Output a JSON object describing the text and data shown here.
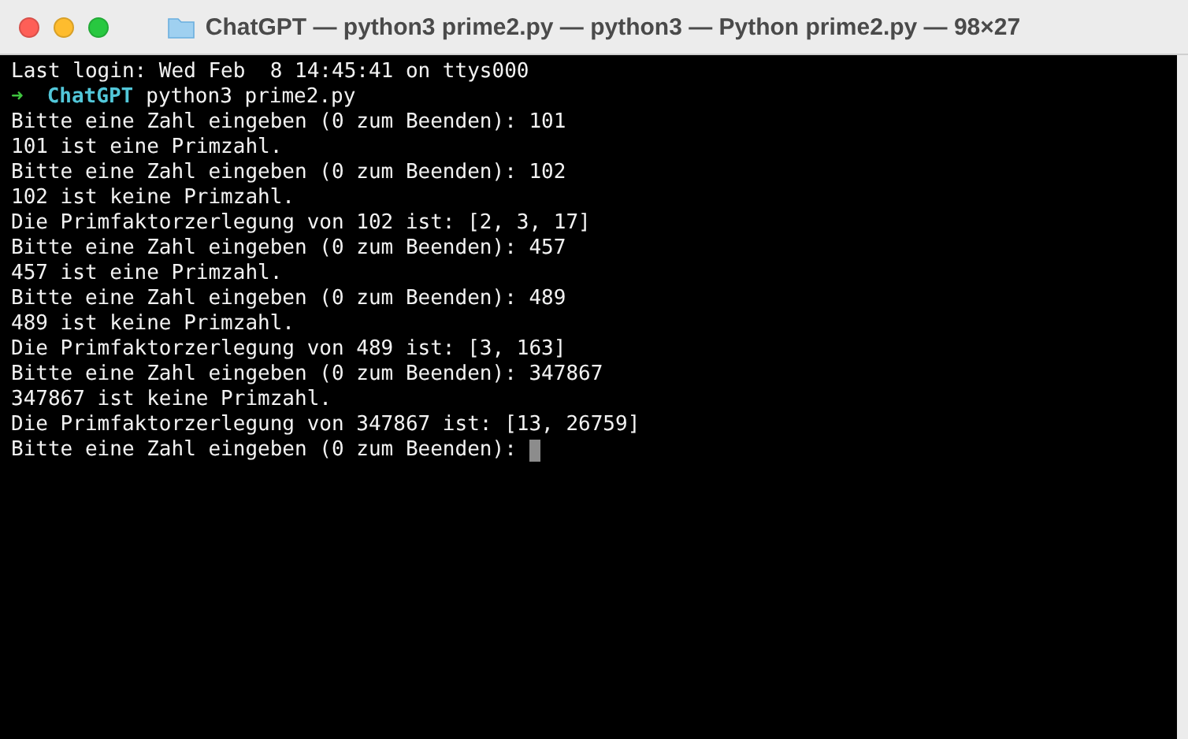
{
  "window": {
    "title": "ChatGPT — python3 prime2.py — python3 — Python prime2.py — 98×27"
  },
  "terminal": {
    "lines": [
      {
        "kind": "output",
        "text": "Last login: Wed Feb  8 14:45:41 on ttys000"
      },
      {
        "kind": "prompt",
        "arrow": "➜",
        "directory": "ChatGPT",
        "command": "python3 prime2.py"
      },
      {
        "kind": "output",
        "text": "Bitte eine Zahl eingeben (0 zum Beenden): 101"
      },
      {
        "kind": "output",
        "text": "101 ist eine Primzahl."
      },
      {
        "kind": "output",
        "text": "Bitte eine Zahl eingeben (0 zum Beenden): 102"
      },
      {
        "kind": "output",
        "text": "102 ist keine Primzahl."
      },
      {
        "kind": "output",
        "text": "Die Primfaktorzerlegung von 102 ist: [2, 3, 17]"
      },
      {
        "kind": "output",
        "text": "Bitte eine Zahl eingeben (0 zum Beenden): 457"
      },
      {
        "kind": "output",
        "text": "457 ist eine Primzahl."
      },
      {
        "kind": "output",
        "text": "Bitte eine Zahl eingeben (0 zum Beenden): 489"
      },
      {
        "kind": "output",
        "text": "489 ist keine Primzahl."
      },
      {
        "kind": "output",
        "text": "Die Primfaktorzerlegung von 489 ist: [3, 163]"
      },
      {
        "kind": "output",
        "text": "Bitte eine Zahl eingeben (0 zum Beenden): 347867"
      },
      {
        "kind": "output",
        "text": "347867 ist keine Primzahl."
      },
      {
        "kind": "output",
        "text": "Die Primfaktorzerlegung von 347867 ist: [13, 26759]"
      },
      {
        "kind": "input",
        "text": "Bitte eine Zahl eingeben (0 zum Beenden):"
      }
    ]
  }
}
